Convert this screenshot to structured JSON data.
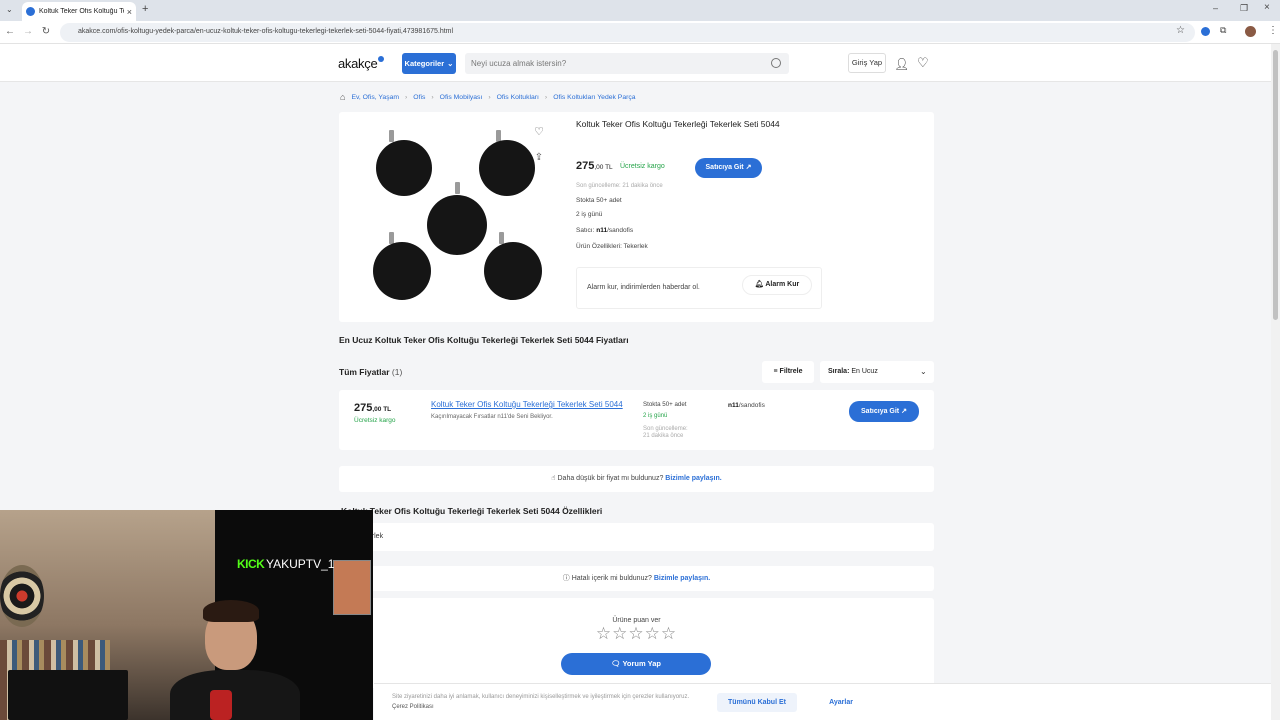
{
  "browser": {
    "tab_title": "Koltuk Teker Ofis Koltuğu Teker",
    "url": "akakce.com/ofis-koltugu-yedek-parca/en-ucuz-koltuk-teker-ofis-koltugu-tekerlegi-tekerlek-seti-5044-fiyati,473981675.html"
  },
  "header": {
    "logo": "akakçe",
    "categories_label": "Kategoriler",
    "search_placeholder": "Neyi ucuza almak istersin?",
    "login_label": "Giriş Yap"
  },
  "breadcrumb": [
    "Ev, Ofis, Yaşam",
    "Ofis",
    "Ofis Mobilyası",
    "Ofis Koltukları",
    "Ofis Koltukları Yedek Parça"
  ],
  "product": {
    "title": "Koltuk Teker Ofis Koltuğu Tekerleği Tekerlek Seti 5044",
    "price_main": "275",
    "price_cents": ",00 TL",
    "cargo": "Ücretsiz kargo",
    "go_button": "Satıcıya Git",
    "updated": "Son güncelleme: 21 dakika önce",
    "stock": "Stokta 50+ adet",
    "delivery": "2 iş günü",
    "seller_label": "Satıcı:",
    "seller_brand": "n11",
    "seller_name": "/sandofis",
    "props": "Ürün Özellikleri: Tekerlek",
    "alarm_text": "Alarm kur, indirimlerden haberdar ol.",
    "alarm_button": "Alarm Kur"
  },
  "prices_section": {
    "title": "En Ucuz Koltuk Teker Ofis Koltuğu Tekerleği Tekerlek Seti 5044 Fiyatları",
    "all_prices_label": "Tüm Fiyatlar",
    "all_prices_count": "(1)",
    "filter_label": "Filtrele",
    "sort_label": "Sırala:",
    "sort_value": "En Ucuz"
  },
  "offer": {
    "price_main": "275",
    "price_cents": ",00 TL",
    "cargo": "Ücretsiz kargo",
    "title": "Koltuk Teker Ofis Koltuğu Tekerleği Tekerlek Seti 5044",
    "subtitle": "Kaçırılmayacak Fırsatlar n11'de Seni Bekliyor.",
    "stock": "Stokta 50+ adet",
    "delivery": "2 iş günü",
    "updated": "Son güncelleme: 21 dakika önce",
    "seller_brand": "n11",
    "seller_name": "/sandofis",
    "go_button": "Satıcıya Git"
  },
  "lower_price": {
    "text": "Daha düşük bir fiyat mı buldunuz?",
    "link": "Bizimle paylaşın."
  },
  "specs": {
    "title": "Koltuk Teker Ofis Koltuğu Tekerleği Tekerlek Seti 5044 Özellikleri",
    "value": "Tekerlek"
  },
  "error_report": {
    "text": "Hatalı içerik mi buldunuz?",
    "link": "Bizimle paylaşın."
  },
  "review": {
    "rate_label": "Ürüne puan ver",
    "stars": "☆☆☆☆☆",
    "button": "Yorum Yap"
  },
  "cookie": {
    "text": "Site ziyaretinizi daha iyi anlamak, kullanıcı deneyiminizi kişiselleştirmek ve iyileştirmek için çerezler kullanıyoruz.",
    "policy_link": "Çerez Politikası",
    "accept": "Tümünü Kabul Et",
    "settings": "Ayarlar"
  },
  "stream_overlay": {
    "platform": "KICK",
    "username": "YAKUPTV_1"
  }
}
